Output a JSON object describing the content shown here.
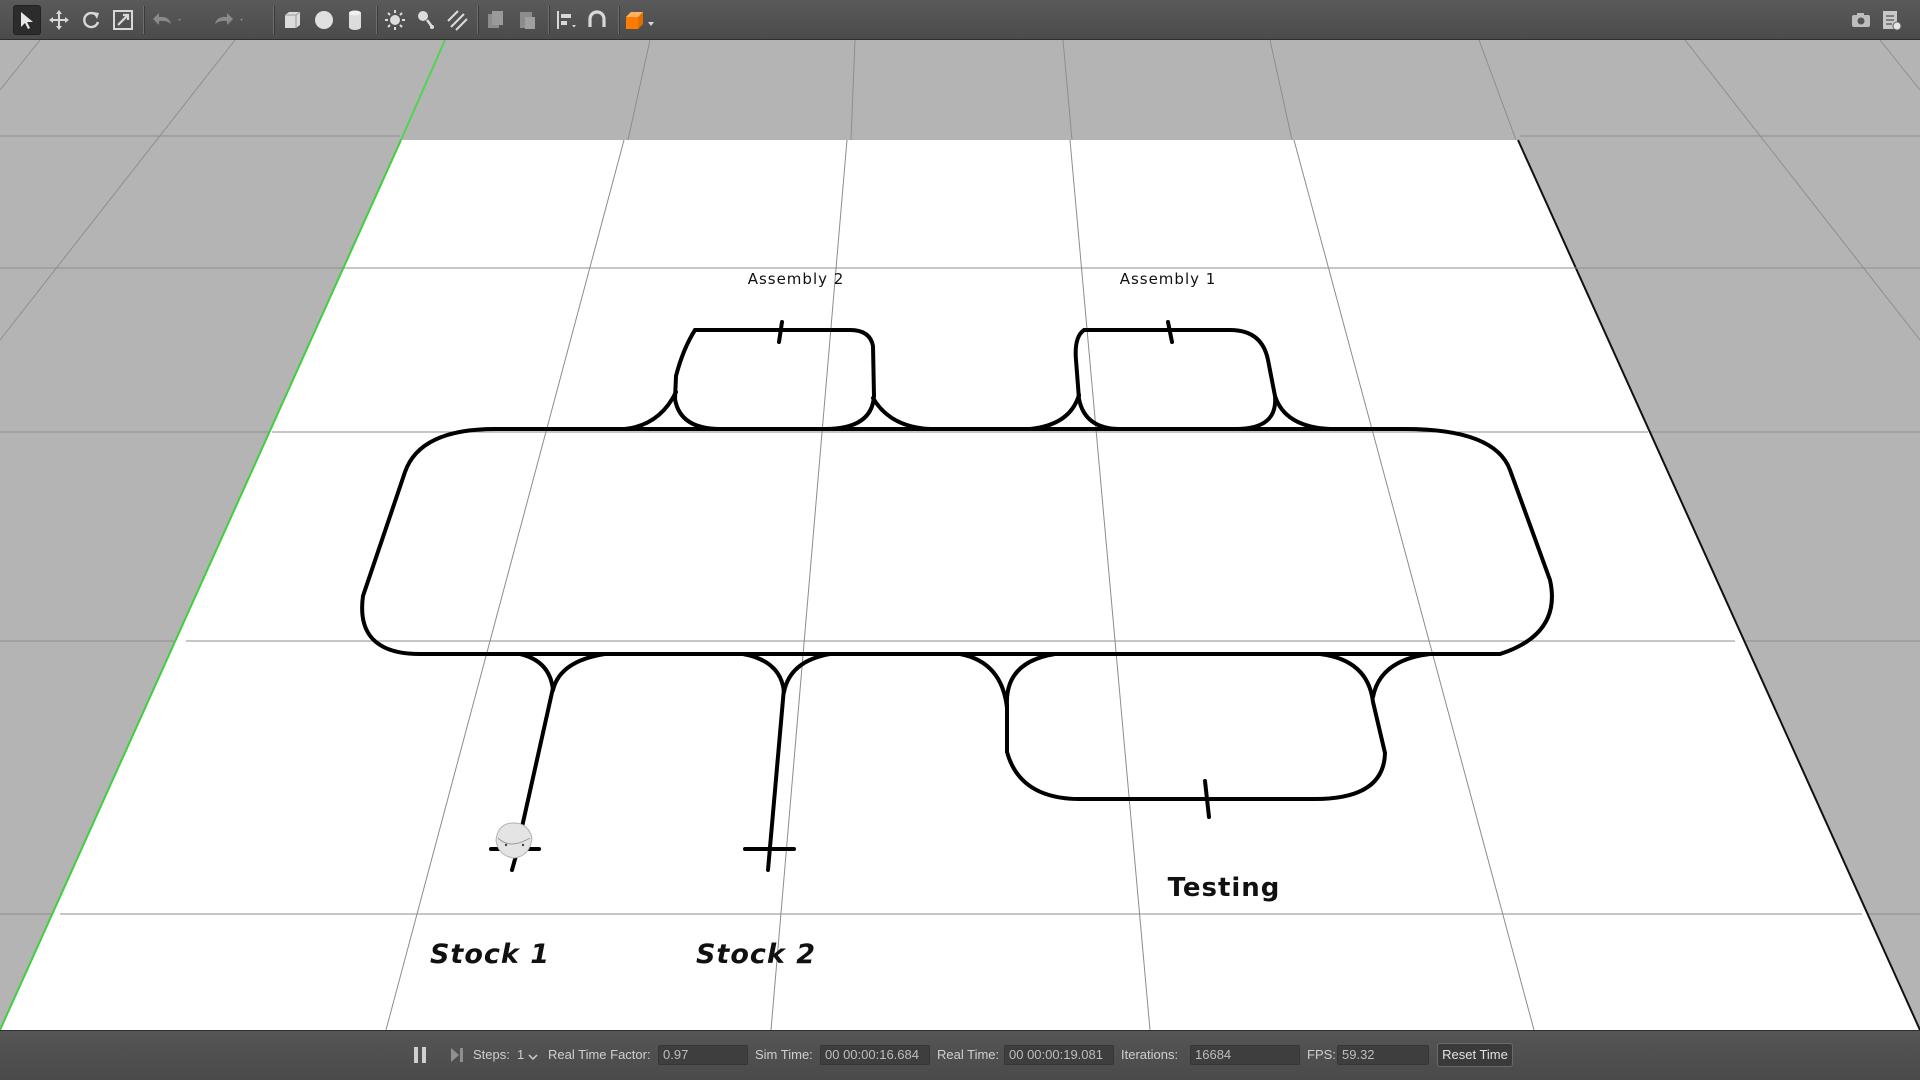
{
  "toolbar": {
    "tools": [
      {
        "name": "select-mode-icon",
        "active": true
      },
      {
        "name": "translate-mode-icon",
        "active": false
      },
      {
        "name": "rotate-mode-icon",
        "active": false
      },
      {
        "name": "scale-mode-icon",
        "active": false
      },
      {
        "name": "undo-icon",
        "active": false
      },
      {
        "name": "redo-icon",
        "active": false
      },
      {
        "name": "box-shape-icon",
        "active": false
      },
      {
        "name": "sphere-shape-icon",
        "active": false
      },
      {
        "name": "cylinder-shape-icon",
        "active": false
      },
      {
        "name": "point-light-icon",
        "active": false
      },
      {
        "name": "spot-light-icon",
        "active": false
      },
      {
        "name": "directional-light-icon",
        "active": false
      },
      {
        "name": "copy-icon",
        "active": false
      },
      {
        "name": "paste-icon",
        "active": false
      },
      {
        "name": "align-icon",
        "active": false
      },
      {
        "name": "snap-icon",
        "active": false
      },
      {
        "name": "view-angle-icon",
        "active": false
      },
      {
        "name": "screenshot-icon",
        "active": false
      },
      {
        "name": "log-icon",
        "active": false
      }
    ]
  },
  "scene": {
    "labels": {
      "assembly_2": "Assembly 2",
      "assembly_1": "Assembly 1",
      "stock_1": "Stock 1",
      "stock_2": "Stock 2",
      "testing": "Testing"
    }
  },
  "bottom": {
    "steps_label": "Steps:",
    "steps_value": "1",
    "rtf_label": "Real Time Factor:",
    "rtf_value": "0.97",
    "sim_time_label": "Sim Time:",
    "sim_time_value": "00 00:00:16.684",
    "real_time_label": "Real Time:",
    "real_time_value": "00 00:00:19.081",
    "iterations_label": "Iterations:",
    "iterations_value": "16684",
    "fps_label": "FPS:",
    "fps_value": "59.32",
    "reset_label": "Reset Time"
  },
  "colors": {
    "toolbar_bg": "#505050",
    "viewport_bg": "#b4b4b4",
    "ground_plane": "#ffffff",
    "track_line": "#000000",
    "grid_line": "#8c8c8c",
    "x_axis_green": "#52d352",
    "shape_orange": "#ff7a00"
  }
}
